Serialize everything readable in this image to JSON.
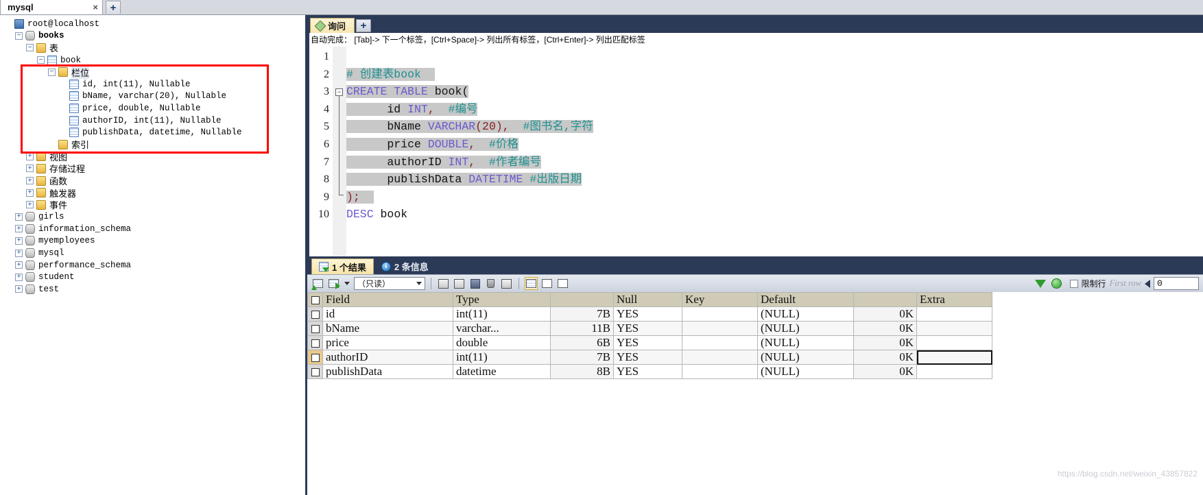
{
  "window": {
    "connection_tab": "mysql",
    "close_label": "×",
    "new_tab_label": "+"
  },
  "sidebar": {
    "root": {
      "label": "root@localhost",
      "icon": "server-icon"
    },
    "nodes": [
      {
        "label": "books",
        "icon": "database-icon",
        "indent": 1,
        "expander": "−",
        "bold": true
      },
      {
        "label": "表",
        "icon": "folder-icon",
        "indent": 2,
        "expander": "−",
        "cjk": true
      },
      {
        "label": "book",
        "icon": "table-icon",
        "indent": 3,
        "expander": "−"
      },
      {
        "label": "栏位",
        "icon": "folder-icon",
        "indent": 4,
        "expander": "−",
        "cjk": true,
        "selected": true
      },
      {
        "label": "id, int(11), Nullable",
        "icon": "column-icon",
        "indent": 5,
        "expander": ""
      },
      {
        "label": "bName, varchar(20), Nullable",
        "icon": "column-icon",
        "indent": 5,
        "expander": ""
      },
      {
        "label": "price, double, Nullable",
        "icon": "column-icon",
        "indent": 5,
        "expander": ""
      },
      {
        "label": "authorID, int(11), Nullable",
        "icon": "column-icon",
        "indent": 5,
        "expander": ""
      },
      {
        "label": "publishData, datetime, Nullable",
        "icon": "column-icon",
        "indent": 5,
        "expander": ""
      },
      {
        "label": "索引",
        "icon": "folder-icon",
        "indent": 4,
        "expander": "",
        "cjk": true
      },
      {
        "label": "视图",
        "icon": "folder-icon",
        "indent": 2,
        "expander": "+",
        "cjk": true
      },
      {
        "label": "存储过程",
        "icon": "folder-icon",
        "indent": 2,
        "expander": "+",
        "cjk": true
      },
      {
        "label": "函数",
        "icon": "folder-icon",
        "indent": 2,
        "expander": "+",
        "cjk": true
      },
      {
        "label": "触发器",
        "icon": "folder-icon",
        "indent": 2,
        "expander": "+",
        "cjk": true
      },
      {
        "label": "事件",
        "icon": "folder-icon",
        "indent": 2,
        "expander": "+",
        "cjk": true
      },
      {
        "label": "girls",
        "icon": "database-icon",
        "indent": 1,
        "expander": "+"
      },
      {
        "label": "information_schema",
        "icon": "database-icon",
        "indent": 1,
        "expander": "+"
      },
      {
        "label": "myemployees",
        "icon": "database-icon",
        "indent": 1,
        "expander": "+"
      },
      {
        "label": "mysql",
        "icon": "database-icon",
        "indent": 1,
        "expander": "+"
      },
      {
        "label": "performance_schema",
        "icon": "database-icon",
        "indent": 1,
        "expander": "+"
      },
      {
        "label": "student",
        "icon": "database-icon",
        "indent": 1,
        "expander": "+"
      },
      {
        "label": "test",
        "icon": "database-icon",
        "indent": 1,
        "expander": "+"
      }
    ],
    "highlight_color": "#ff0000"
  },
  "query": {
    "tab_label": "询问",
    "new_tab_label": "+",
    "hint": "自动完成： [Tab]-> 下一个标签，[Ctrl+Space]-> 列出所有标签，[Ctrl+Enter]-> 列出匹配标签",
    "line_numbers": [
      "1",
      "2",
      "3",
      "4",
      "5",
      "6",
      "7",
      "8",
      "9",
      "10"
    ],
    "lines": [
      {
        "n": 1,
        "segments": []
      },
      {
        "n": 2,
        "segments": [
          {
            "t": "# 创建表book",
            "c": "cmt",
            "hl": true
          },
          {
            "t": "  ",
            "c": "plain",
            "hl": true
          }
        ]
      },
      {
        "n": 3,
        "segments": [
          {
            "t": "CREATE TABLE ",
            "c": "kw",
            "hl": true
          },
          {
            "t": "book(",
            "c": "plain",
            "hl": true
          }
        ]
      },
      {
        "n": 4,
        "segments": [
          {
            "t": "      id ",
            "c": "plain",
            "hl": true
          },
          {
            "t": "INT",
            "c": "kw",
            "hl": true
          },
          {
            "t": ",",
            "c": "pun",
            "hl": true
          },
          {
            "t": "  ",
            "c": "plain",
            "hl": true
          },
          {
            "t": "#编号",
            "c": "cmt",
            "hl": true
          }
        ]
      },
      {
        "n": 5,
        "segments": [
          {
            "t": "      bName ",
            "c": "plain",
            "hl": true
          },
          {
            "t": "VARCHAR",
            "c": "kw",
            "hl": true
          },
          {
            "t": "(20)",
            "c": "pun",
            "hl": true
          },
          {
            "t": ",",
            "c": "pun",
            "hl": true
          },
          {
            "t": "  ",
            "c": "plain",
            "hl": true
          },
          {
            "t": "#图书名,字符",
            "c": "cmt",
            "hl": true
          }
        ]
      },
      {
        "n": 6,
        "segments": [
          {
            "t": "      price ",
            "c": "plain",
            "hl": true
          },
          {
            "t": "DOUBLE",
            "c": "kw",
            "hl": true
          },
          {
            "t": ",",
            "c": "pun",
            "hl": true
          },
          {
            "t": "  ",
            "c": "plain",
            "hl": true
          },
          {
            "t": "#价格",
            "c": "cmt",
            "hl": true
          }
        ]
      },
      {
        "n": 7,
        "segments": [
          {
            "t": "      authorID ",
            "c": "plain",
            "hl": true
          },
          {
            "t": "INT",
            "c": "kw",
            "hl": true
          },
          {
            "t": ",",
            "c": "pun",
            "hl": true
          },
          {
            "t": "  ",
            "c": "plain",
            "hl": true
          },
          {
            "t": "#作者编号",
            "c": "cmt",
            "hl": true
          }
        ]
      },
      {
        "n": 8,
        "segments": [
          {
            "t": "      publishData ",
            "c": "plain",
            "hl": true
          },
          {
            "t": "DATETIME",
            "c": "kw",
            "hl": true
          },
          {
            "t": " ",
            "c": "plain",
            "hl": true
          },
          {
            "t": "#出版日期",
            "c": "cmt",
            "hl": true
          }
        ]
      },
      {
        "n": 9,
        "segments": [
          {
            "t": ")",
            "c": "pun",
            "hl": true
          },
          {
            "t": ";",
            "c": "pun",
            "hl": true
          },
          {
            "t": "  ",
            "c": "plain",
            "hl": true
          }
        ]
      },
      {
        "n": 10,
        "segments": [
          {
            "t": "DESC",
            "c": "kw",
            "hl": false
          },
          {
            "t": " book",
            "c": "plain",
            "hl": false
          }
        ]
      }
    ]
  },
  "results": {
    "tabs": [
      {
        "label": "1 个结果",
        "icon": "result-grid-icon",
        "active": true
      },
      {
        "label": "2 条信息",
        "icon": "info-icon",
        "active": false
      }
    ],
    "toolbar": {
      "mode_select_value": "（只读）",
      "icons": [
        "add-record-icon",
        "export-record-icon",
        "copy-icon",
        "paste-icon",
        "save-icon",
        "delete-icon",
        "refresh-record-icon",
        "grid-view-icon",
        "form-view-icon",
        "text-view-icon",
        "filter-icon",
        "refresh-icon"
      ],
      "limit_checkbox_label": "限制行",
      "limit_checked": false,
      "first_row_label": "First row",
      "row_value": "0",
      "nav_prev_icon": "prev-arrow-icon"
    },
    "grid": {
      "columns": [
        "Field",
        "Type",
        "",
        "Null",
        "Key",
        "Default",
        "",
        "Extra"
      ],
      "rows": [
        {
          "field": "id",
          "type": "int(11)",
          "size": "7B",
          "null": "YES",
          "key": "",
          "default": "(NULL)",
          "ok": "0K",
          "extra": ""
        },
        {
          "field": "bName",
          "type": "varchar...",
          "size": "11B",
          "null": "YES",
          "key": "",
          "default": "(NULL)",
          "ok": "0K",
          "extra": ""
        },
        {
          "field": "price",
          "type": "double",
          "size": "6B",
          "null": "YES",
          "key": "",
          "default": "(NULL)",
          "ok": "0K",
          "extra": ""
        },
        {
          "field": "authorID",
          "type": "int(11)",
          "size": "7B",
          "null": "YES",
          "key": "",
          "default": "(NULL)",
          "ok": "0K",
          "extra": "",
          "selected": true
        },
        {
          "field": "publishData",
          "type": "datetime",
          "size": "8B",
          "null": "YES",
          "key": "",
          "default": "(NULL)",
          "ok": "0K",
          "extra": ""
        }
      ]
    }
  },
  "watermark": "https://blog.csdn.net/weixin_43857822"
}
